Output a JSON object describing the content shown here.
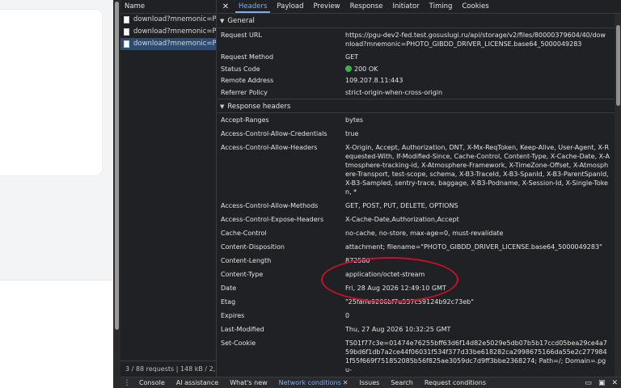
{
  "requests": {
    "header": "Name",
    "items": [
      {
        "name": "download?mnemonic=PHOTO_GIBDD_DRIVER_LICENSE",
        "selected": false
      },
      {
        "name": "download?mnemonic=PHOTO_GIBDD_DRIVER_LICENSE",
        "selected": false
      },
      {
        "name": "download?mnemonic=PHOTO_GIBDD_DRIVER_LICENSE",
        "selected": true
      }
    ],
    "status": "3 / 88 requests  |  148 kB / 2,"
  },
  "tabs": [
    "Headers",
    "Payload",
    "Preview",
    "Response",
    "Initiator",
    "Timing",
    "Cookies"
  ],
  "active_tab": "Headers",
  "general": {
    "title": "General",
    "rows": [
      {
        "k": "Request URL",
        "v": "https://pgu-dev2-fed.test.gosuslugi.ru/api/storage/v2/files/80000379604/40/download?mnemonic=PHOTO_GIBDD_DRIVER_LICENSE.base64_5000049283"
      },
      {
        "k": "Request Method",
        "v": "GET"
      },
      {
        "k": "Status Code",
        "v": "200 OK"
      },
      {
        "k": "Remote Address",
        "v": "109.207.8.11:443"
      },
      {
        "k": "Referrer Policy",
        "v": "strict-origin-when-cross-origin"
      }
    ]
  },
  "response": {
    "title": "Response headers",
    "rows": [
      {
        "k": "Accept-Ranges",
        "v": "bytes"
      },
      {
        "k": "Access-Control-Allow-Credentials",
        "v": "true"
      },
      {
        "k": "Access-Control-Allow-Headers",
        "v": "X-Origin, Accept, Authorization, DNT, X-Mx-ReqToken, Keep-Alive, User-Agent, X-Requested-With, If-Modified-Since, Cache-Control, Content-Type, X-Cache-Date, X-Atmosphere-tracking-id, X-Atmosphere-Framework, X-TimeZone-Offset, X-Atmosphere-Transport, test-scope, schema, X-B3-TraceId, X-B3-SpanId, X-B3-ParentSpanId, X-B3-Sampled, sentry-trace, baggage, X-B3-Podname, X-Session-Id, X-Single-Token, *"
      },
      {
        "k": "Access-Control-Allow-Methods",
        "v": "GET, POST, PUT, DELETE, OPTIONS"
      },
      {
        "k": "Access-Control-Expose-Headers",
        "v": "X-Cache-Date,Authorization,Accept"
      },
      {
        "k": "Cache-Control",
        "v": "no-cache, no-store, max-age=0, must-revalidate"
      },
      {
        "k": "Content-Disposition",
        "v": "attachment; filename=\"PHOTO_GIBDD_DRIVER_LICENSE.base64_5000049283\""
      },
      {
        "k": "Content-Length",
        "v": "872580"
      },
      {
        "k": "Content-Type",
        "v": "application/octet-stream"
      },
      {
        "k": "Date",
        "v": "Fri, 28 Aug 2026 12:49:10 GMT"
      },
      {
        "k": "Etag",
        "v": "\"25faffe9206bf7a557c59124b92c73eb\""
      },
      {
        "k": "Expires",
        "v": "0"
      },
      {
        "k": "Last-Modified",
        "v": "Thu, 27 Aug 2026 10:32:25 GMT"
      },
      {
        "k": "Set-Cookie",
        "v": "TS01f77c3e=01474e76255bff63d6f14d82e5029e5db07b5b17ccd05bea29ce4a759bd6f1db7a2ce44f06031f534f377d33be618282ca2998675166da55e2c2779841f55f669f751852085b56f825ae3059dc7d9ff3bbe2368274; Path=/; Domain=.pgu-"
      }
    ]
  },
  "drawer": {
    "tabs": [
      "Console",
      "AI assistance",
      "What's new",
      "Network conditions",
      "Issues",
      "Search",
      "Request conditions"
    ],
    "active": "Network conditions"
  },
  "colors": {
    "accent": "#7cacf8",
    "status_ok": "#39b24a",
    "annotation": "#c8102e"
  }
}
